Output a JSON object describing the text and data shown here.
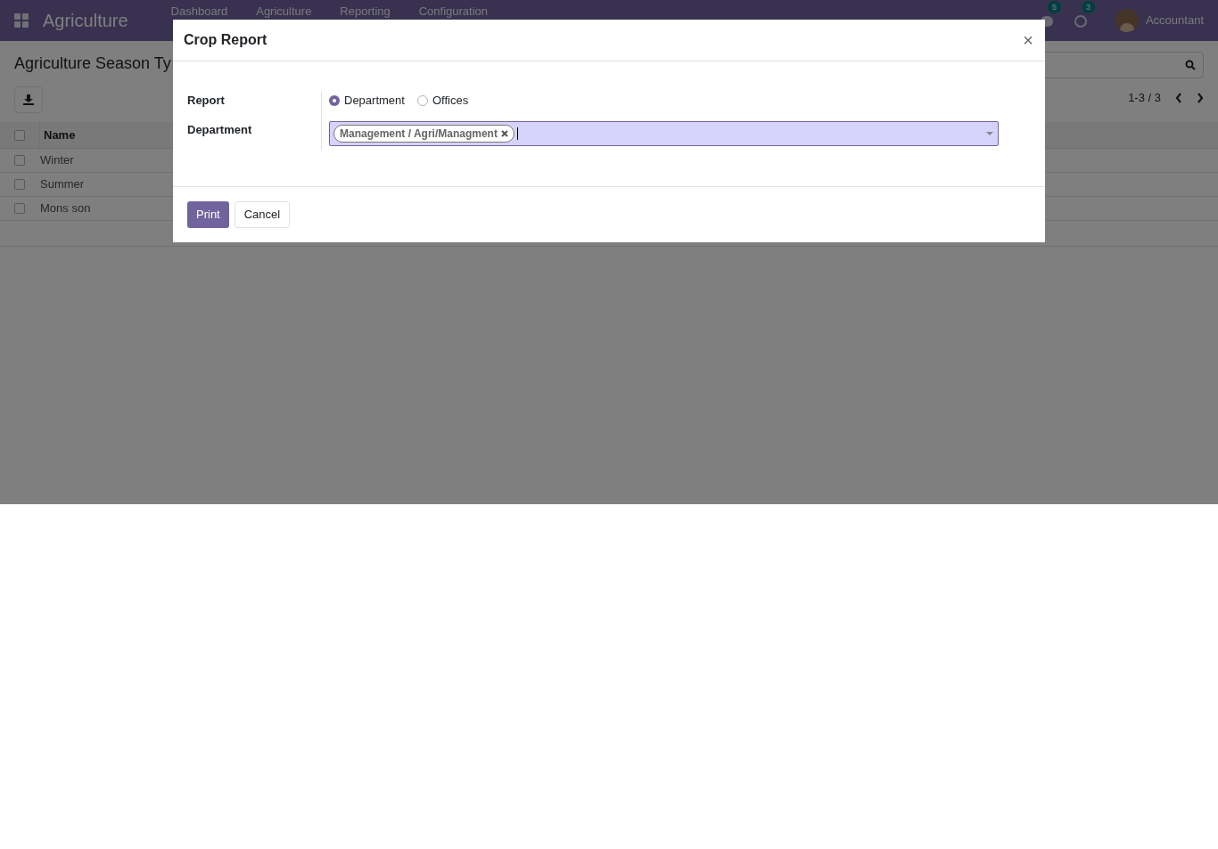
{
  "navbar": {
    "app_name": "Agriculture",
    "menu": [
      "Dashboard",
      "Agriculture",
      "Reporting",
      "Configuration"
    ],
    "messages_count": "5",
    "activities_count": "3",
    "user": "Accountant"
  },
  "page": {
    "title": "Agriculture Season Ty",
    "pager": "1-3 / 3"
  },
  "table": {
    "select_all_checked": false,
    "columns": [
      "Name"
    ],
    "rows": [
      {
        "name": "Winter",
        "checked": false
      },
      {
        "name": "Summer",
        "checked": false
      },
      {
        "name": "Mons son",
        "checked": false
      }
    ]
  },
  "dialog": {
    "title": "Crop Report",
    "close": "×",
    "fields": [
      {
        "kind": "radio",
        "label": "Report",
        "options": [
          {
            "label": "Department",
            "selected": true
          },
          {
            "label": "Offices",
            "selected": false
          }
        ]
      },
      {
        "kind": "tags",
        "label": "Department",
        "tags": [
          "Management / Agri/Managment"
        ]
      }
    ],
    "buttons": [
      {
        "label": "Print",
        "primary": true
      },
      {
        "label": "Cancel",
        "primary": false
      }
    ]
  }
}
